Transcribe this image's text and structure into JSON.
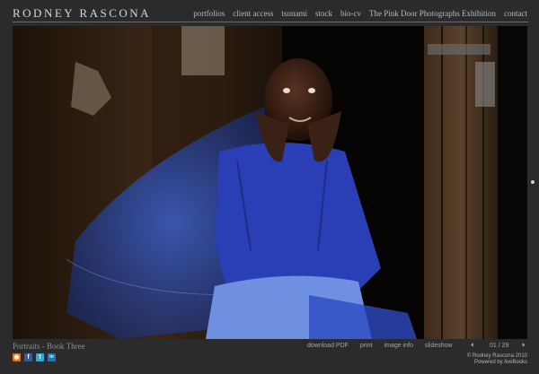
{
  "header": {
    "brand": "RODNEY RASCONA",
    "nav": [
      "portfolios",
      "client access",
      "tsunami",
      "stock",
      "bio-cv",
      "The Pink Door Photographs Exhibition",
      "contact"
    ]
  },
  "photo": {
    "alt": "Portrait of a girl in a blue sweater under a blue mosquito net"
  },
  "footer": {
    "caption": "Portraits - Book Three",
    "tools": [
      "download PDF",
      "print",
      "image info",
      "slideshow"
    ],
    "pager": {
      "prev": "⏴",
      "count": "01 / 29",
      "next": "⏵"
    },
    "social": [
      {
        "icon": "rss-icon",
        "glyph": "◉",
        "color": "#e0721e"
      },
      {
        "icon": "facebook-icon",
        "glyph": "f",
        "color": "#3b5a9a"
      },
      {
        "icon": "twitter-icon",
        "glyph": "t",
        "color": "#33a9d8"
      },
      {
        "icon": "linkedin-icon",
        "glyph": "in",
        "color": "#1b77b5"
      }
    ],
    "copyright": [
      "© Rodney Rascona 2010",
      "Powered by liveBooks"
    ]
  }
}
